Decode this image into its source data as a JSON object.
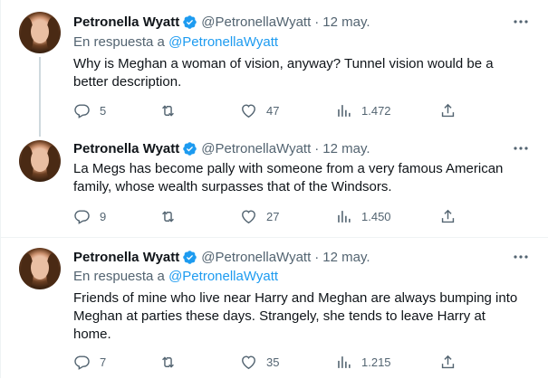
{
  "tweets": [
    {
      "author": "Petronella Wyatt",
      "handle": "@PetronellaWyatt",
      "separator": "·",
      "date": "12 may.",
      "reply_prefix": "En respuesta a",
      "reply_handle": "@PetronellaWyatt",
      "lines": [
        "Why is Meghan a woman of vision, anyway? Tunnel vision would be a",
        "better description."
      ],
      "replies": "5",
      "retweets": "",
      "likes": "47",
      "views": "1.472"
    },
    {
      "author": "Petronella Wyatt",
      "handle": "@PetronellaWyatt",
      "separator": "·",
      "date": "12 may.",
      "lines": [
        "La Megs has become pally with someone from a very famous American",
        "family, whose wealth surpasses that of the Windsors."
      ],
      "replies": "9",
      "retweets": "",
      "likes": "27",
      "views": "1.450"
    },
    {
      "author": "Petronella Wyatt",
      "handle": "@PetronellaWyatt",
      "separator": "·",
      "date": "12 may.",
      "reply_prefix": "En respuesta a",
      "reply_handle": "@PetronellaWyatt",
      "lines": [
        "Friends of mine who live near Harry and Meghan are always bumping into",
        "Meghan at parties these days. Strangely, she tends to leave Harry at",
        "home."
      ],
      "replies": "7",
      "retweets": "",
      "likes": "35",
      "views": "1.215"
    }
  ],
  "icons": {
    "verified": "verified-badge-icon",
    "more": "more-options-icon",
    "reply": "reply-icon",
    "retweet": "retweet-icon",
    "like": "heart-icon",
    "views": "views-chart-icon",
    "share": "share-icon"
  },
  "colors": {
    "text": "#0f1419",
    "secondary": "#536471",
    "accent": "#1d9bf0",
    "thread_line": "#cfd9de",
    "divider": "#eff3f4"
  }
}
